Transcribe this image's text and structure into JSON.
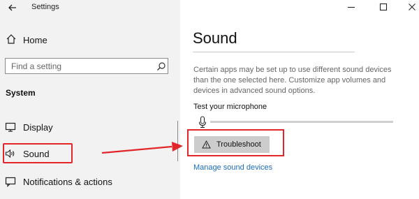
{
  "window": {
    "title": "Settings",
    "controls": [
      "minimize",
      "maximize",
      "close"
    ]
  },
  "sidebar": {
    "home_label": "Home",
    "search": {
      "placeholder": "Find a setting"
    },
    "section_heading": "System",
    "items": [
      {
        "label": "Display",
        "icon": "display-icon"
      },
      {
        "label": "Sound",
        "icon": "speaker-icon"
      },
      {
        "label": "Notifications & actions",
        "icon": "notifications-icon"
      }
    ]
  },
  "main": {
    "title": "Sound",
    "description": "Certain apps may be set up to use different sound devices than the one selected here. Customize app volumes and devices in advanced sound options.",
    "test_mic_label": "Test your microphone",
    "troubleshoot_label": "Troubleshoot",
    "manage_link": "Manage sound devices"
  },
  "annotation": {
    "highlight_color": "#e3262a"
  },
  "colors": {
    "sidebar_bg": "#f2f2f2",
    "button_bg": "#cccccc",
    "link": "#1a6dbf"
  }
}
